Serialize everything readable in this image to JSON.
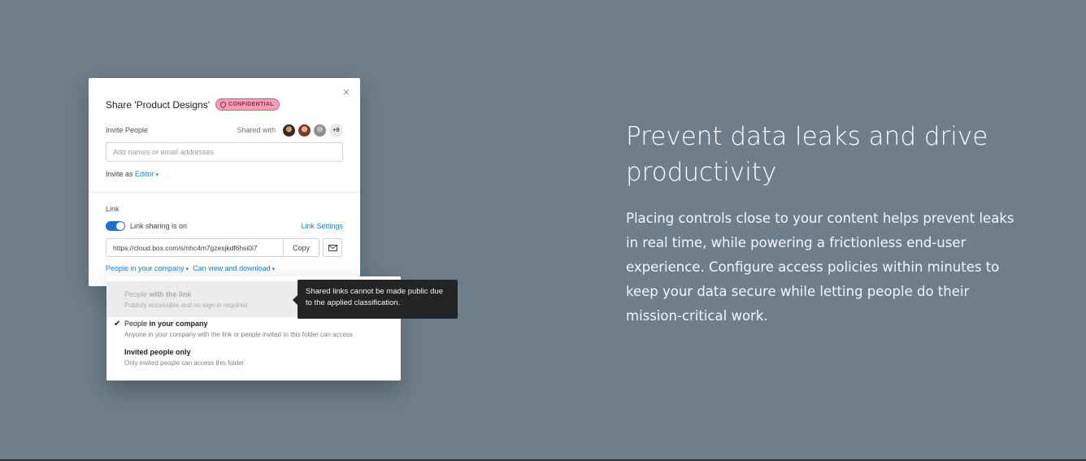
{
  "share_dialog": {
    "title": "Share 'Product Designs'",
    "close_glyph": "×",
    "classification_badge": "CONFIDENTIAL",
    "invite_people_label": "Invite People",
    "shared_with_label": "Shared with",
    "shared_with_more": "+9",
    "invite_placeholder": "Add names or email addresses",
    "invite_as_label": "Invite as",
    "invite_as_role": "Editor",
    "link_heading": "Link",
    "link_sharing_status": "Link sharing is on",
    "link_sharing_enabled": true,
    "link_settings_label": "Link Settings",
    "shared_link_url": "https://cloud.box.com/s/nhc4m7gzesjkdf6hsi0i7",
    "copy_label": "Copy",
    "access_scope": "People in your company",
    "access_permission": "Can view and download"
  },
  "access_dropdown": {
    "items": [
      {
        "title_prefix": "People",
        "title_bold": "with the link",
        "subtitle": "Publicly accessible and no sign-in required",
        "disabled": true,
        "selected": false
      },
      {
        "title_prefix": "People",
        "title_bold": "in your company",
        "subtitle": "Anyone in your company with the link or people invited to this folder can access",
        "disabled": false,
        "selected": true
      },
      {
        "title_prefix": "",
        "title_bold": "Invited people only",
        "subtitle": "Only invited people can access this folder",
        "disabled": false,
        "selected": false
      }
    ]
  },
  "tooltip": {
    "text": "Shared links cannot be made public due to the applied classification."
  },
  "marketing": {
    "headline": "Prevent data leaks and drive productivity",
    "body": "Placing controls close to your content helps prevent leaks in real time, while powering a frictionless end-user experience. Configure access policies within minutes to keep your data secure while letting people do their mission-critical work."
  },
  "colors": {
    "page_background": "#6e7f8b",
    "accent_blue": "#1f7fd6",
    "badge_pink": "#f2a1b6",
    "tooltip_bg": "#222426"
  },
  "icons": [
    "close-icon",
    "shield-icon",
    "email-icon",
    "check-icon",
    "caret-down-icon"
  ]
}
